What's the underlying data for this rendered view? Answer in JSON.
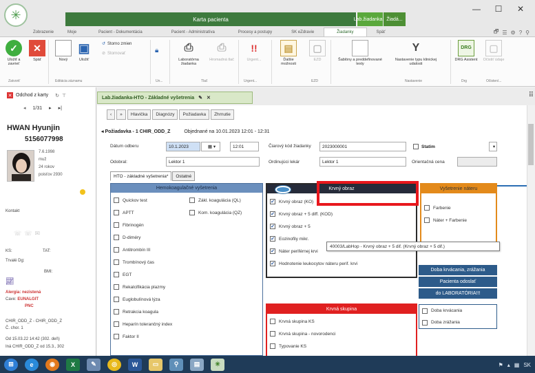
{
  "window": {
    "title": "Karta pacienta",
    "ctx_tab_1": "Lab.žiadanka...",
    "ctx_tab_2": "Žiadá...",
    "min": "—",
    "max": "☐",
    "close": "✕"
  },
  "ribbon_tabs": [
    "Zobrazenie",
    "Moje",
    "Pacient - Dokumentácia",
    "Pacient - Administratíva",
    "Procesy a postupy",
    "SK eZdravie",
    "Žiadanky",
    "Späť"
  ],
  "ribbon_tab_icons": [
    "🗗",
    "☰",
    "⚙",
    "?",
    "⚲"
  ],
  "ribbon": {
    "ulozit_zavriet": "Uložiť a zavrieť",
    "spat": "Späť",
    "novy": "Nový",
    "ulozit": "Uložiť",
    "storno_zmien": "Storno zmien",
    "stornovat": "Stornovať",
    "laboratorna": "Laboratórna žiadanka",
    "hromadna_tlac": "Hromadná tlač",
    "urgent": "Urgent...",
    "dalsie_moznosti": "Ďalšie možnosti",
    "ezd": "EZD",
    "sablony": "Šablóny a preddefinované texty",
    "nastavenie": "Nastavenie typu klinickej udalosti",
    "drg": "DRG Asistent",
    "ocistit": "Očistiť údaje",
    "grp_zatvorit": "Zatvoriť",
    "grp_editacia": "Editácia záznamu",
    "grp_un": "Un...",
    "grp_tlac": "Tlač",
    "grp_urgent": "Urgent...",
    "grp_ezd": "EZD",
    "grp_nastavenie": "Nastavenie",
    "grp_drg": "Drg",
    "grp_ocistit": "Očistení..."
  },
  "left": {
    "odchod": "Odchod z karty",
    "pager": "1/31",
    "patient_name": "HWAN Hyunjin",
    "patient_id": "5156077998",
    "dob": "7.6.1998",
    "sex": "muž",
    "age": "24 rokov",
    "poistovna": "poisťov 2930",
    "kontakt": "Kontakt",
    "ks": "KS:",
    "tat": "TAT:",
    "trvale_dg": "Trvalé Dg:",
    "bmi": "BMI:",
    "alergia": "Alergia: nezistená",
    "cave": "Cave:",
    "cave_value": "EUNALGIT",
    "pnc": "PNC",
    "dept1": "CHIR_ODD_Z - CHIR_ODD_Z",
    "dept2": "Č. chor. 1",
    "dept3": "Od 15.03.22 14:42 (302. deň)",
    "dept4": "Iná CHIR_ODD_Z od 15.3., 302"
  },
  "doc_tab": {
    "label": "Lab.žiadanka-HTO - Základné vyšetrenia"
  },
  "subtabs": [
    "Hlavička",
    "Diagnózy",
    "Požiadavka",
    "Zhrnutie"
  ],
  "request": {
    "header": "Požiadavka - 1 CHIR_ODD_Z",
    "ordered": "Objednané na 10.01.2023 12:01 - 12:31",
    "datum_label": "Dátum odberu",
    "datum_value": "10.1.2023",
    "time_value": "12:01",
    "ciarovy_label": "Čiarový kód žiadanky",
    "ciarovy_value": "2023000001",
    "statim_label": "Statim",
    "odobral_label": "Odobral:",
    "odobral_value": "Lektor 1",
    "ordinujuci_label": "Ordinujúci lekár",
    "ordinujuci_value": "Lektor 1",
    "orientacna_label": "Orientačná cena"
  },
  "form_tabs": [
    "HTO - základné vyšetrenia*",
    "Ostatné"
  ],
  "hemo": {
    "title": "Hemokoagulačné vyšetrenia",
    "left_items": [
      "Quickov test",
      "APTT",
      "Fibrinogén",
      "D-diméry",
      "Antitrombín III",
      "Trombínový čas",
      "EGT",
      "Rekalcifikácia plazmy",
      "Euglobulínová lýza",
      "Retrakcia koagula",
      "Heparín tolerančný index",
      "Faktor II"
    ],
    "right_items": [
      "Zákl. koagulácia (QL)",
      "Kom. koagulácia (QZ)"
    ]
  },
  "krvny": {
    "title": "Krvný obraz",
    "items": [
      "Krvný obraz (KO)",
      "Krvný obraz + 5 diff. (KOD)",
      "Krvný obraz + 5",
      "Eozinofily mikr.",
      "Náter periférnej krvi",
      "Hodnotenie leukocytov náteru perif. krvi"
    ]
  },
  "tooltip": "40003/LabHop - Krvný obraz + 5 dif. (Krvný obraz + 5 dif.)",
  "orange": {
    "title": "Vyšetrenie náteru",
    "items": [
      "Farbenie",
      "Náter + Farbenie"
    ]
  },
  "blue_buttons": [
    "Doba krvácania, zrážania",
    "Pacienta odoslať",
    "do LABORATÓRIA!!!"
  ],
  "doba": {
    "items": [
      "Doba krvácania",
      "Doba zrážania"
    ]
  },
  "skupina": {
    "title": "Krvná skupina",
    "items": [
      "Krvná skupina KS",
      "Krvná skupina - novorodenci",
      "Typovanie KS"
    ]
  },
  "taskbar": {
    "tray_text": "SK"
  }
}
